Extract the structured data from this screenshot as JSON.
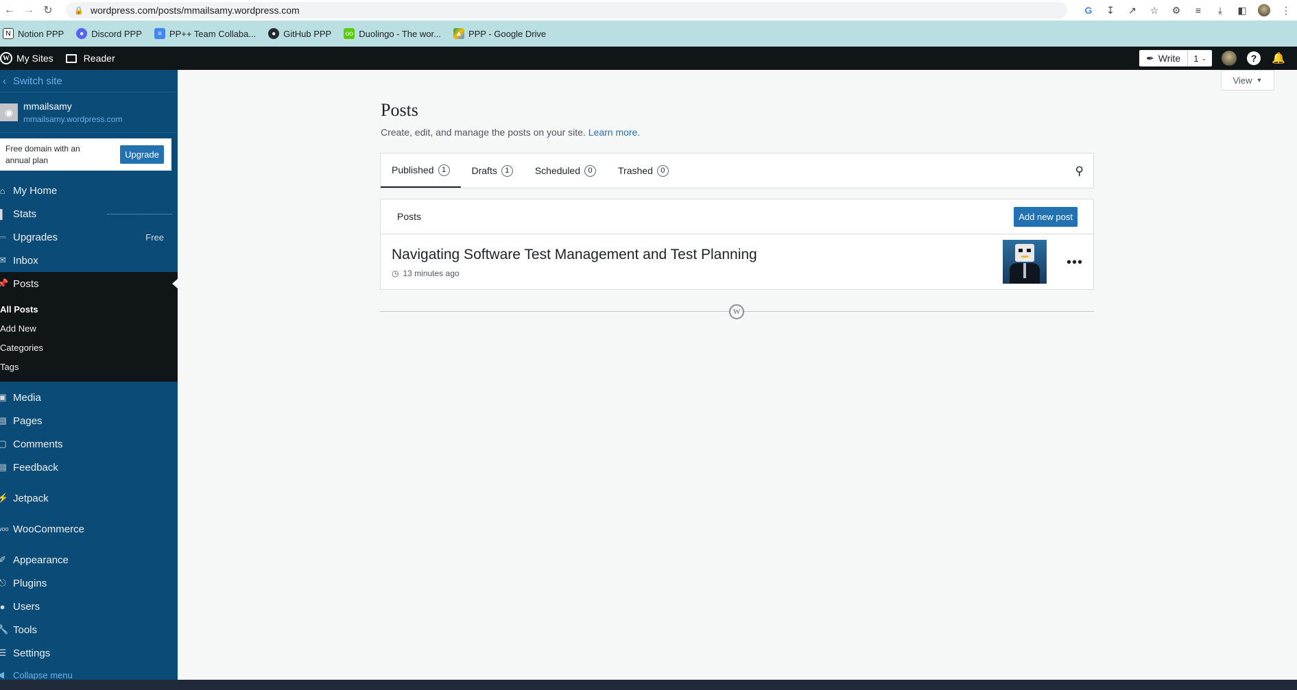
{
  "browser": {
    "url": "wordpress.com/posts/mmailsamy.wordpress.com",
    "bookmarks": [
      {
        "label": "Notion PPP",
        "icon": "notion-icon",
        "color": "#ffffff"
      },
      {
        "label": "Discord PPP",
        "icon": "discord-icon",
        "color": "#5865f2"
      },
      {
        "label": "PP++ Team Collaba...",
        "icon": "doc-icon",
        "color": "#4285f4"
      },
      {
        "label": "GitHub PPP",
        "icon": "github-icon",
        "color": "#24292f"
      },
      {
        "label": "Duolingo - The wor...",
        "icon": "duolingo-icon",
        "color": "#58cc02"
      },
      {
        "label": "PPP - Google Drive",
        "icon": "drive-icon",
        "color": "#fbbc04"
      }
    ]
  },
  "masterbar": {
    "my_sites": "My Sites",
    "reader": "Reader",
    "write": "Write",
    "draft_count": "1"
  },
  "sidebar": {
    "switch_site": "Switch site",
    "site_name": "mmailsamy",
    "site_url": "mmailsamy.wordpress.com",
    "promo_text": "Free domain with an annual plan",
    "upgrade": "Upgrade",
    "items": {
      "my_home": "My Home",
      "stats": "Stats",
      "upgrades": "Upgrades",
      "upgrades_badge": "Free",
      "inbox": "Inbox",
      "posts": "Posts",
      "media": "Media",
      "pages": "Pages",
      "comments": "Comments",
      "feedback": "Feedback",
      "jetpack": "Jetpack",
      "woocommerce": "WooCommerce",
      "appearance": "Appearance",
      "plugins": "Plugins",
      "users": "Users",
      "tools": "Tools",
      "settings": "Settings"
    },
    "submenu": {
      "all_posts": "All Posts",
      "add_new": "Add New",
      "categories": "Categories",
      "tags": "Tags"
    },
    "collapse": "Collapse menu"
  },
  "main": {
    "view": "View",
    "title": "Posts",
    "subtitle": "Create, edit, and manage the posts on your site.",
    "learn_more": "Learn more.",
    "tabs": [
      {
        "label": "Published",
        "count": "1"
      },
      {
        "label": "Drafts",
        "count": "1"
      },
      {
        "label": "Scheduled",
        "count": "0"
      },
      {
        "label": "Trashed",
        "count": "0"
      }
    ],
    "list_header": "Posts",
    "add_new_post": "Add new post",
    "post": {
      "title": "Navigating Software Test Management and Test Planning",
      "time": "13 minutes ago"
    }
  }
}
